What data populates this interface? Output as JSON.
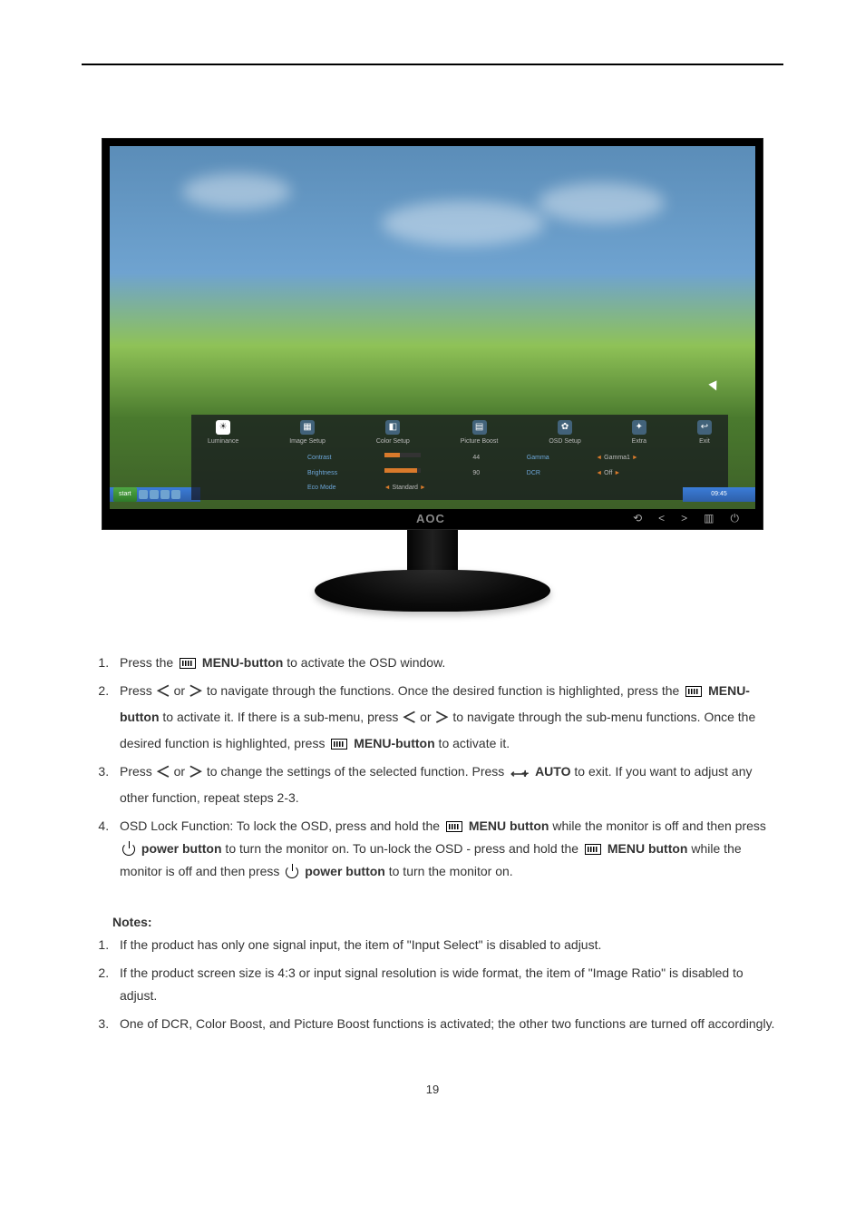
{
  "monitor": {
    "logo": "AOC",
    "osd": {
      "tabs": [
        {
          "label": "Luminance",
          "glyph": "☀"
        },
        {
          "label": "Image Setup",
          "glyph": "▦"
        },
        {
          "label": "Color Setup",
          "glyph": "◧"
        },
        {
          "label": "Picture Boost",
          "glyph": "▤"
        },
        {
          "label": "OSD Setup",
          "glyph": "✿"
        },
        {
          "label": "Extra",
          "glyph": "✦"
        },
        {
          "label": "Exit",
          "glyph": "↩"
        }
      ],
      "settings": {
        "contrast_label": "Contrast",
        "contrast_value": "44",
        "brightness_label": "Brightness",
        "brightness_value": "90",
        "eco_label": "Eco Mode",
        "eco_value": "Standard",
        "gamma_label": "Gamma",
        "gamma_value": "Gamma1",
        "dcr_label": "DCR",
        "dcr_value": "Off"
      }
    },
    "taskbar": {
      "start": "start",
      "time": "09:45"
    },
    "bezel_controls": [
      "⟲",
      "<",
      ">",
      "▥",
      "⏻"
    ]
  },
  "instructions": {
    "step1_a": "Press the ",
    "step1_b": "MENU-button",
    "step1_c": " to activate the OSD window.",
    "step2_a": "Press ",
    "step2_b": "or",
    "step2_c": " to navigate through the functions. Once the desired function is highlighted, press the ",
    "step2_d": "MENU-button",
    "step2_e": " to activate it. If there is a sub-menu, press ",
    "step2_f": "or",
    "step2_g": " to navigate through the sub-menu functions. Once the desired function is highlighted, press ",
    "step2_h": "MENU-button",
    "step2_i": " to activate it.",
    "step3_a": "Press ",
    "step3_b": "or",
    "step3_c": " to change the settings of the selected function. Press ",
    "step3_d": "AUTO",
    "step3_e": " to exit.    If you want to adjust any other function, repeat steps 2-3.",
    "step4_a": "OSD Lock Function: To lock the OSD, press and hold the ",
    "step4_b": "MENU button",
    "step4_c": " while the monitor is off and then press ",
    "step4_d": "power button",
    "step4_e": " to turn the monitor on. To un-lock the OSD - press and hold the ",
    "step4_f": "MENU button",
    "step4_g": " while the monitor is off and then press ",
    "step4_h": "power button",
    "step4_i": " to turn the monitor on."
  },
  "notes_heading": "Notes:",
  "notes": {
    "n1": "If the product has only one signal input, the item of \"Input Select\" is disabled to adjust.",
    "n2": "If the product screen size is 4:3 or input signal resolution is wide format, the item of \"Image Ratio\" is disabled to adjust.",
    "n3": "One of DCR, Color Boost, and Picture Boost functions is activated; the other two functions are turned off accordingly."
  },
  "page_number": "19"
}
